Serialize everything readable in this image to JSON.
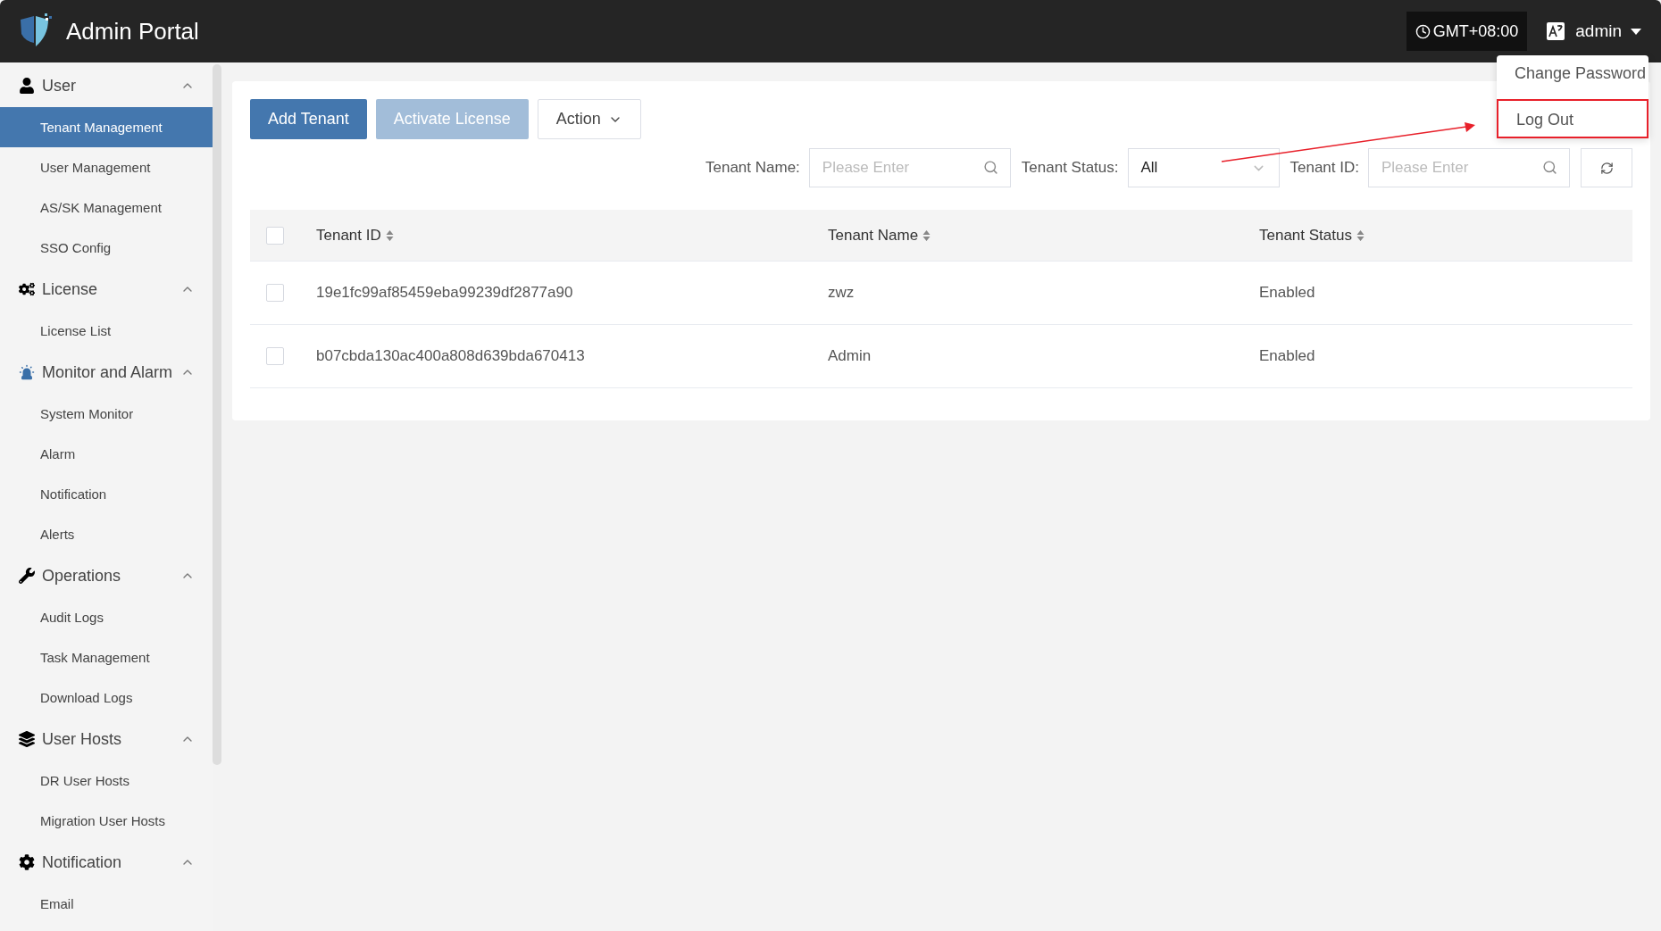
{
  "header": {
    "title": "Admin Portal",
    "timezone": "GMT+08:00",
    "user": "admin"
  },
  "user_menu": {
    "items": [
      {
        "label": "Change Password",
        "highlighted": false
      },
      {
        "label": "Log Out",
        "highlighted": true
      }
    ]
  },
  "sidebar": {
    "groups": [
      {
        "label": "User",
        "expanded": true,
        "items": [
          {
            "label": "Tenant Management",
            "selected": true
          },
          {
            "label": "User Management",
            "selected": false
          },
          {
            "label": "AS/SK Management",
            "selected": false
          },
          {
            "label": "SSO Config",
            "selected": false
          }
        ]
      },
      {
        "label": "License",
        "expanded": true,
        "items": [
          {
            "label": "License List",
            "selected": false
          }
        ]
      },
      {
        "label": "Monitor and Alarm",
        "expanded": true,
        "items": [
          {
            "label": "System Monitor",
            "selected": false
          },
          {
            "label": "Alarm",
            "selected": false
          },
          {
            "label": "Notification",
            "selected": false
          },
          {
            "label": "Alerts",
            "selected": false
          }
        ]
      },
      {
        "label": "Operations",
        "expanded": true,
        "items": [
          {
            "label": "Audit Logs",
            "selected": false
          },
          {
            "label": "Task Management",
            "selected": false
          },
          {
            "label": "Download Logs",
            "selected": false
          }
        ]
      },
      {
        "label": "User Hosts",
        "expanded": true,
        "items": [
          {
            "label": "DR User Hosts",
            "selected": false
          },
          {
            "label": "Migration User Hosts",
            "selected": false
          }
        ]
      },
      {
        "label": "Notification",
        "expanded": true,
        "items": [
          {
            "label": "Email",
            "selected": false
          }
        ]
      }
    ]
  },
  "toolbar": {
    "buttons": [
      {
        "label": "Add Tenant",
        "kind": "primary",
        "disabled": false
      },
      {
        "label": "Activate License",
        "kind": "primary",
        "disabled": true
      },
      {
        "label": "Action",
        "kind": "dropdown",
        "disabled": false
      }
    ]
  },
  "filters": [
    {
      "label": "Tenant Name:",
      "kind": "search",
      "placeholder": "Please Enter"
    },
    {
      "label": "Tenant Status:",
      "kind": "select",
      "value": "All"
    },
    {
      "label": "Tenant ID:",
      "kind": "search",
      "placeholder": "Please Enter"
    }
  ],
  "table": {
    "select_all_checked": false,
    "columns": [
      "Tenant ID",
      "Tenant Name",
      "Tenant Status"
    ],
    "rows": [
      {
        "checked": false,
        "cells": [
          "19e1fc99af85459eba99239df2877a90",
          "zwz",
          "Enabled"
        ]
      },
      {
        "checked": false,
        "cells": [
          "b07cbda130ac400a808d639bda670413",
          "Admin",
          "Enabled"
        ]
      }
    ]
  }
}
